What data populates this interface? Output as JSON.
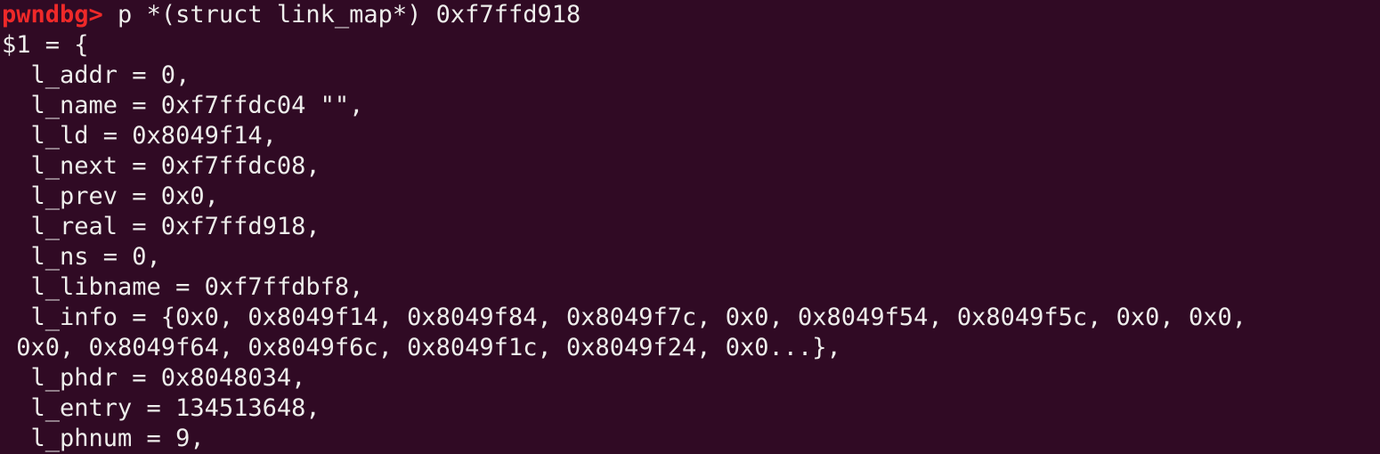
{
  "terminal": {
    "prompt": "pwndbg>",
    "command": " p *(struct link_map*) 0xf7ffd918",
    "output": [
      "$1 = {",
      "  l_addr = 0,",
      "  l_name = 0xf7ffdc04 \"\",",
      "  l_ld = 0x8049f14,",
      "  l_next = 0xf7ffdc08,",
      "  l_prev = 0x0,",
      "  l_real = 0xf7ffd918,",
      "  l_ns = 0,",
      "  l_libname = 0xf7ffdbf8,",
      "  l_info = {0x0, 0x8049f14, 0x8049f84, 0x8049f7c, 0x0, 0x8049f54, 0x8049f5c, 0x0, 0x0,",
      " 0x0, 0x8049f64, 0x8049f6c, 0x8049f1c, 0x8049f24, 0x0...},",
      "  l_phdr = 0x8048034,",
      "  l_entry = 134513648,",
      "  l_phnum = 9,"
    ]
  },
  "colors": {
    "background": "#300a24",
    "prompt": "#ef2929",
    "text": "#eeeeec"
  }
}
